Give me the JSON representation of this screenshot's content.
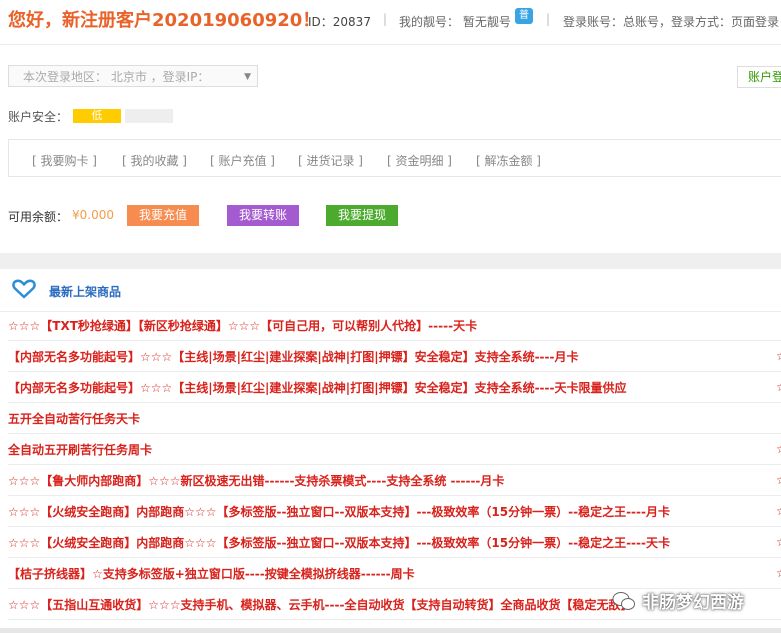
{
  "header": {
    "greeting": "您好，新注册客户202019060920！",
    "id_text": "ID：20837",
    "separator": "|",
    "nickname": "我的靓号：  暂无靓号",
    "nick_badge": "普",
    "login_info": "登录账号：总账号，登录方式：页面登录"
  },
  "region": {
    "text": "本次登录地区：  北京市  ，登录IP：",
    "arrow": "▼"
  },
  "right_button": "账户登录",
  "security": {
    "label": "账户安全：",
    "level": "低"
  },
  "quick_links": [
    "[ 我要购卡 ]",
    "[ 我的收藏 ]",
    "[ 账户充值 ]",
    "[ 进货记录 ]",
    "[ 资金明细 ]",
    "[ 解冻金额 ]"
  ],
  "balance": {
    "label": "可用余额：",
    "value": "¥0.000",
    "recharge": "我要充值",
    "transfer": "我要转账",
    "withdraw": "我要提现"
  },
  "newest": {
    "title": "最新上架商品"
  },
  "products": [
    "☆☆☆【TXT秒抢绿通】【新区秒抢绿通】☆☆☆【可自己用，可以帮别人代抢】-----天卡",
    "【内部无名多功能起号】☆☆☆【主线|场景|红尘|建业探案|战神|打图|押镖】安全稳定】支持全系统----月卡",
    "【内部无名多功能起号】☆☆☆【主线|场景|红尘|建业探案|战神|打图|押镖】安全稳定】支持全系统----天卡限量供应",
    "五开全自动苦行任务天卡",
    "全自动五开刷苦行任务周卡",
    "☆☆☆【鲁大师内部跑商】☆☆☆新区极速无出错------支持杀票模式----支持全系统 ------月卡",
    "☆☆☆【火绒安全跑商】内部跑商☆☆☆【多标签版--独立窗口--双版本支持】---极致效率（15分钟一票）--稳定之王----月卡",
    "☆☆☆【火绒安全跑商】内部跑商☆☆☆【多标签版--独立窗口--双版本支持】---极致效率（15分钟一票）--稳定之王----天卡",
    "【桔子挤线器】☆支持多标签版+独立窗口版----按键全模拟挤线器------周卡",
    "☆☆☆【五指山互通收货】☆☆☆支持手机、模拟器、云手机----全自动收货【支持自动转货】全商品收货【稳定无敌】"
  ],
  "right_marks": [
    "☆",
    "☆",
    "☆",
    "☆",
    "☆",
    "☆",
    "☆"
  ],
  "watermark": "非肠梦幻西游",
  "colors": {
    "accent": "#e8622a",
    "product_red": "#d9221c",
    "link_blue": "#2a6cbf"
  }
}
